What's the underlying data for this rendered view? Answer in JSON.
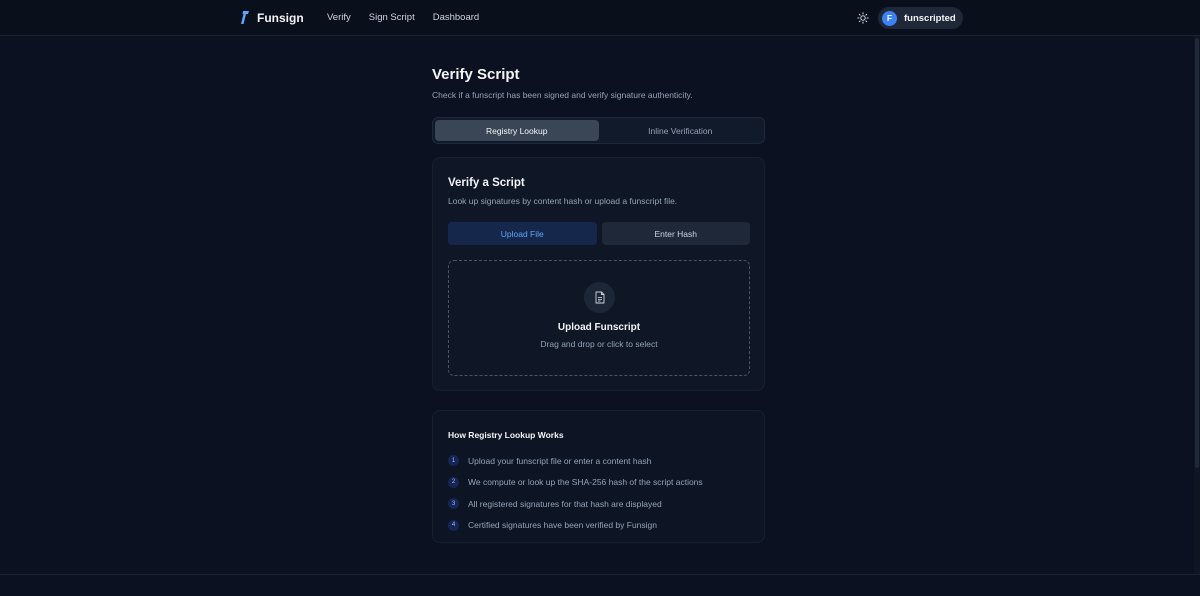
{
  "brand": {
    "name": "Funsign",
    "accent": "#3b82f6"
  },
  "nav": {
    "items": [
      "Verify",
      "Sign Script",
      "Dashboard"
    ]
  },
  "user": {
    "initial": "F",
    "name": "funscripted"
  },
  "page": {
    "title": "Verify Script",
    "subtitle": "Check if a funscript has been signed and verify signature authenticity."
  },
  "mode_tabs": [
    {
      "label": "Registry Lookup",
      "active": true
    },
    {
      "label": "Inline Verification",
      "active": false
    }
  ],
  "verify_card": {
    "title": "Verify a Script",
    "subtitle": "Look up signatures by content hash or upload a funscript file.",
    "source_tabs": [
      {
        "label": "Upload File",
        "active": true
      },
      {
        "label": "Enter Hash",
        "active": false
      }
    ],
    "dropzone": {
      "icon": "file-icon",
      "title": "Upload Funscript",
      "subtitle": "Drag and drop or click to select"
    }
  },
  "info_card": {
    "title": "How Registry Lookup Works",
    "steps": [
      {
        "num": "1",
        "text": "Upload your funscript file or enter a content hash"
      },
      {
        "num": "2",
        "text": "We compute or look up the SHA-256 hash of the script actions"
      },
      {
        "num": "3",
        "text": "All registered signatures for that hash are displayed"
      },
      {
        "num": "4",
        "text": "Certified signatures have been verified by Funsign"
      }
    ]
  }
}
